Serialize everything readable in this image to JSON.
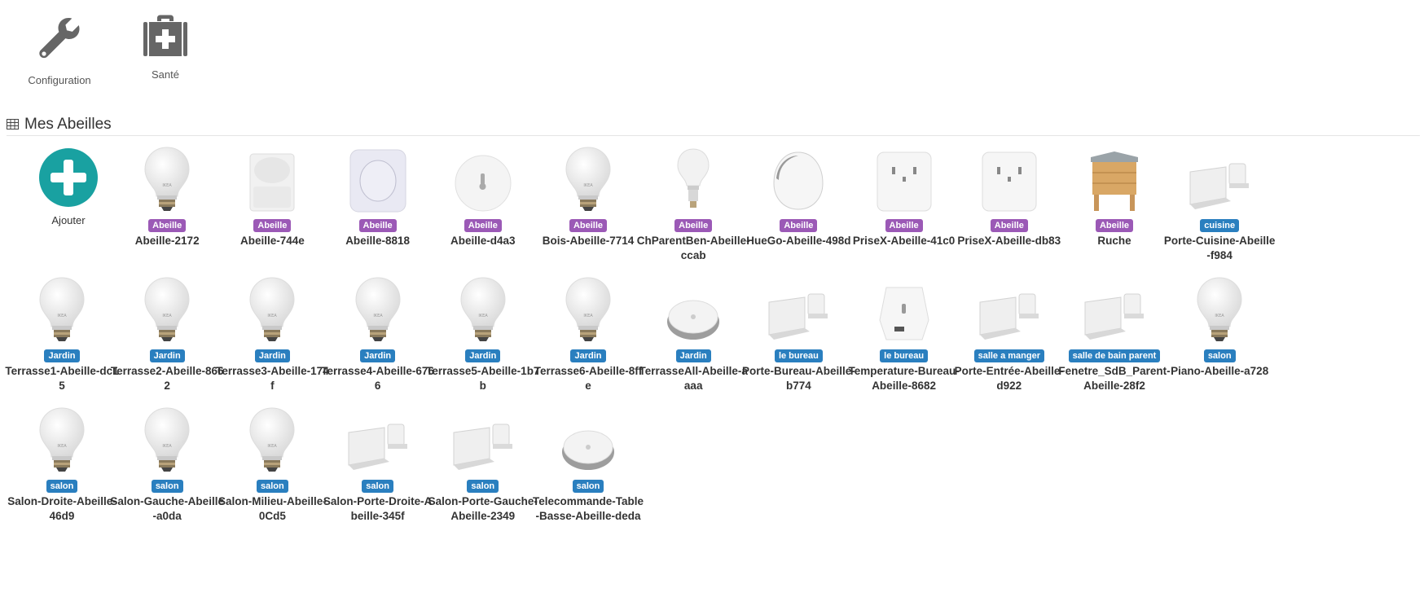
{
  "toolbar": {
    "configuration_label": "Configuration",
    "sante_label": "Santé"
  },
  "section": {
    "title": "Mes Abeilles"
  },
  "add": {
    "label": "Ajouter"
  },
  "colors": {
    "purple_badge": "#9b59b6",
    "blue_badge": "#2a7fbf",
    "add_circle": "#19a1a1"
  },
  "devices": [
    {
      "name": "Abeille-2172",
      "room": "Abeille",
      "icon": "bulb"
    },
    {
      "name": "Abeille-744e",
      "room": "Abeille",
      "icon": "motion-sensor"
    },
    {
      "name": "Abeille-8818",
      "room": "Abeille",
      "icon": "wireless-switch"
    },
    {
      "name": "Abeille-d4a3",
      "room": "Abeille",
      "icon": "temperature-sensor"
    },
    {
      "name": "Bois-Abeille-7714",
      "room": "Abeille",
      "icon": "bulb"
    },
    {
      "name": "ChParentBen-Abeille-ccab",
      "room": "Abeille",
      "icon": "small-bulb"
    },
    {
      "name": "HueGo-Abeille-498d",
      "room": "Abeille",
      "icon": "hue-go"
    },
    {
      "name": "PriseX-Abeille-41c0",
      "room": "Abeille",
      "icon": "smart-plug"
    },
    {
      "name": "PriseX-Abeille-db83",
      "room": "Abeille",
      "icon": "smart-plug"
    },
    {
      "name": "Ruche",
      "room": "Abeille",
      "icon": "beehive"
    },
    {
      "name": "Porte-Cuisine-Abeille-f984",
      "room": "cuisine",
      "icon": "door-sensor"
    },
    {
      "name": "Terrasse1-Abeille-dc15",
      "room": "Jardin",
      "icon": "bulb"
    },
    {
      "name": "Terrasse2-Abeille-8662",
      "room": "Jardin",
      "icon": "bulb"
    },
    {
      "name": "Terrasse3-Abeille-174f",
      "room": "Jardin",
      "icon": "bulb"
    },
    {
      "name": "Terrasse4-Abeille-6766",
      "room": "Jardin",
      "icon": "bulb"
    },
    {
      "name": "Terrasse5-Abeille-1b7b",
      "room": "Jardin",
      "icon": "bulb"
    },
    {
      "name": "Terrasse6-Abeille-8ffe",
      "room": "Jardin",
      "icon": "bulb"
    },
    {
      "name": "TerrasseAll-Abeille-aaaa",
      "room": "Jardin",
      "icon": "remote-dimmer"
    },
    {
      "name": "Porte-Bureau-Abeille-b774",
      "room": "le bureau",
      "icon": "door-sensor"
    },
    {
      "name": "Temperature-Bureau-Abeille-8682",
      "room": "le bureau",
      "icon": "air-sensor"
    },
    {
      "name": "Porte-Entrée-Abeille-d922",
      "room": "salle a manger",
      "icon": "door-sensor"
    },
    {
      "name": "Fenetre_SdB_Parent-Abeille-28f2",
      "room": "salle de bain parent",
      "icon": "door-sensor"
    },
    {
      "name": "Piano-Abeille-a728",
      "room": "salon",
      "icon": "bulb"
    },
    {
      "name": "Salon-Droite-Abeille-46d9",
      "room": "salon",
      "icon": "bulb"
    },
    {
      "name": "Salon-Gauche-Abeille-a0da",
      "room": "salon",
      "icon": "bulb"
    },
    {
      "name": "Salon-Milieu-Abeille-0Cd5",
      "room": "salon",
      "icon": "bulb"
    },
    {
      "name": "Salon-Porte-Droite-Abeille-345f",
      "room": "salon",
      "icon": "door-sensor"
    },
    {
      "name": "Salon-Porte-Gauche-Abeille-2349",
      "room": "salon",
      "icon": "door-sensor"
    },
    {
      "name": "Telecommande-Table-Basse-Abeille-deda",
      "room": "salon",
      "icon": "remote-dimmer"
    }
  ]
}
